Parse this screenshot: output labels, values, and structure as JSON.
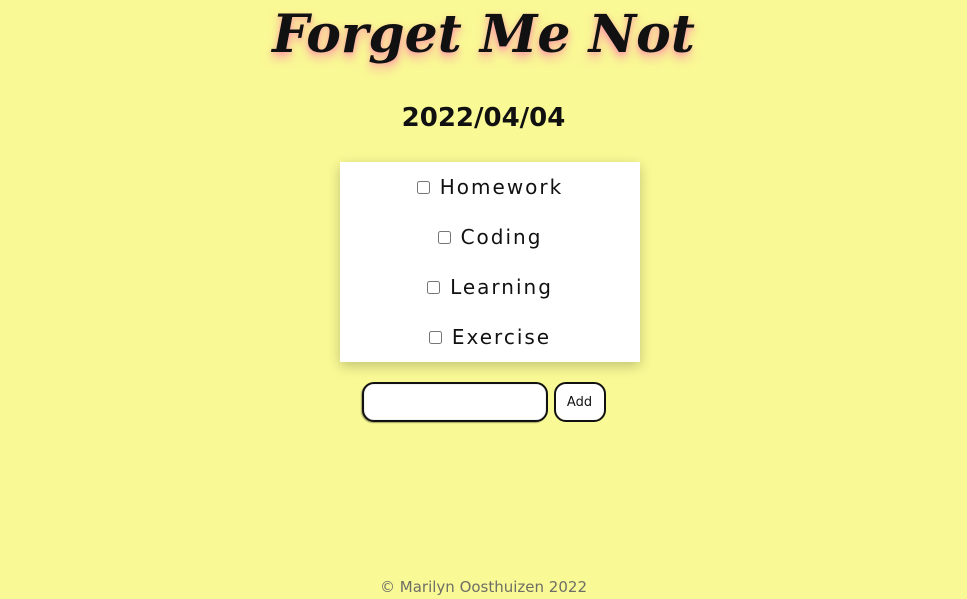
{
  "app": {
    "title": "Forget Me Not",
    "date": "2022/04/04"
  },
  "tasks": [
    {
      "label": "Homework",
      "checked": false
    },
    {
      "label": "Coding",
      "checked": false
    },
    {
      "label": "Learning",
      "checked": false
    },
    {
      "label": "Exercise",
      "checked": false
    }
  ],
  "add_form": {
    "input_value": "",
    "input_placeholder": "",
    "button_label": "Add"
  },
  "footer": {
    "text": "© Marilyn Oosthuizen 2022"
  },
  "colors": {
    "background": "#f9f995",
    "title_glow": "#ff8caa",
    "card": "#ffffff"
  }
}
